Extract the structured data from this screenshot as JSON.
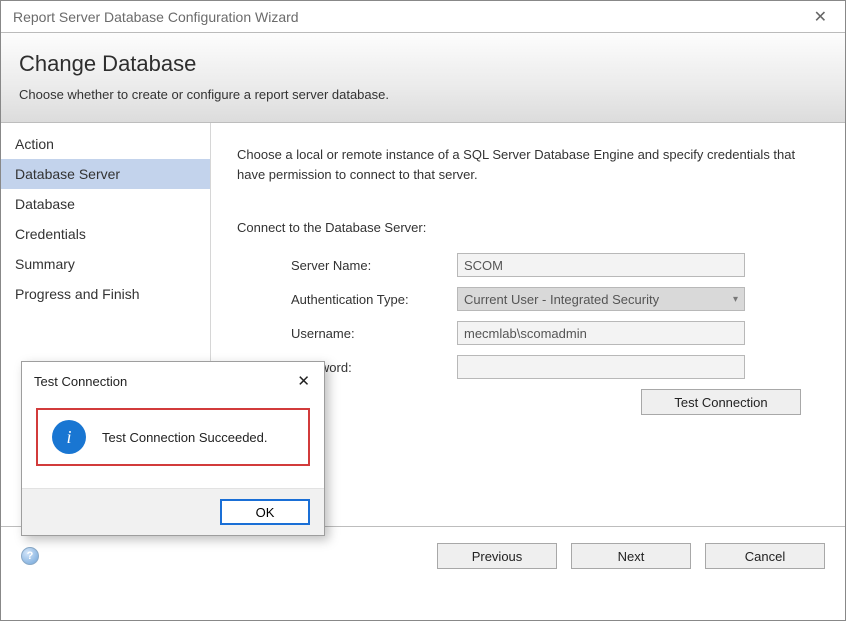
{
  "window": {
    "title": "Report Server Database Configuration Wizard"
  },
  "header": {
    "title": "Change Database",
    "subtitle": "Choose whether to create or configure a report server database."
  },
  "sidebar": {
    "items": [
      {
        "label": "Action"
      },
      {
        "label": "Database Server"
      },
      {
        "label": "Database"
      },
      {
        "label": "Credentials"
      },
      {
        "label": "Summary"
      },
      {
        "label": "Progress and Finish"
      }
    ],
    "selected_index": 1
  },
  "main": {
    "intro": "Choose a local or remote instance of a SQL Server Database Engine and specify credentials that have permission to connect to that server.",
    "section_label": "Connect to the Database Server:",
    "fields": {
      "server_name_label": "Server Name:",
      "server_name_value": "SCOM",
      "auth_type_label": "Authentication Type:",
      "auth_type_value": "Current User - Integrated Security",
      "username_label": "Username:",
      "username_value": "mecmlab\\scomadmin",
      "password_label": "Password:",
      "password_value": ""
    },
    "test_connection_label": "Test Connection"
  },
  "footer": {
    "previous": "Previous",
    "next": "Next",
    "cancel": "Cancel"
  },
  "dialog": {
    "title": "Test Connection",
    "message": "Test Connection Succeeded.",
    "ok": "OK"
  }
}
